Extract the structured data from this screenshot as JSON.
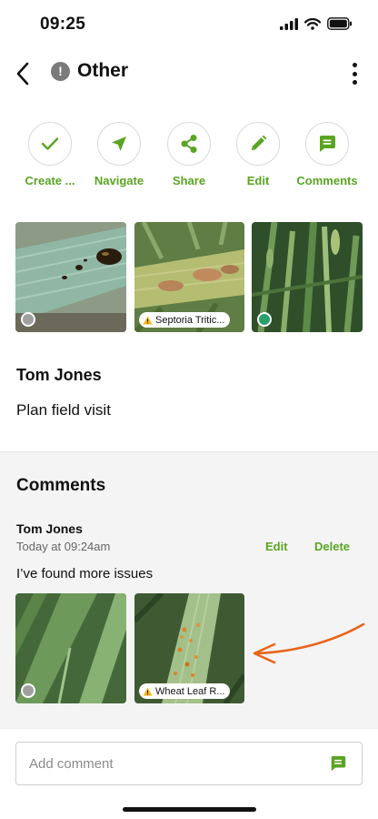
{
  "status_bar": {
    "time": "09:25"
  },
  "header": {
    "title": "Other",
    "info_badge": "!"
  },
  "actions": [
    {
      "label": "Create ...",
      "icon": "check-icon"
    },
    {
      "label": "Navigate",
      "icon": "navigate-icon"
    },
    {
      "label": "Share",
      "icon": "share-icon"
    },
    {
      "label": "Edit",
      "icon": "pencil-icon"
    },
    {
      "label": "Comments",
      "icon": "comment-icon"
    }
  ],
  "photos": [
    {
      "marker": "grey-circle"
    },
    {
      "tag": "Septoria Tritic..."
    },
    {
      "marker": "green-circle"
    }
  ],
  "note": {
    "author": "Tom Jones",
    "text": "Plan field visit"
  },
  "comments": {
    "heading": "Comments",
    "items": [
      {
        "author": "Tom Jones",
        "time": "Today at 09:24am",
        "edit_label": "Edit",
        "delete_label": "Delete",
        "text": "I’ve found more issues",
        "photos": [
          {
            "marker": "grey-circle"
          },
          {
            "tag": "Wheat Leaf R..."
          }
        ]
      }
    ]
  },
  "composer": {
    "placeholder": "Add comment"
  },
  "colors": {
    "accent": "#5aa423",
    "warning": "#f2b81a",
    "marker_green": "#26a269",
    "marker_grey": "#a0a0a0"
  }
}
